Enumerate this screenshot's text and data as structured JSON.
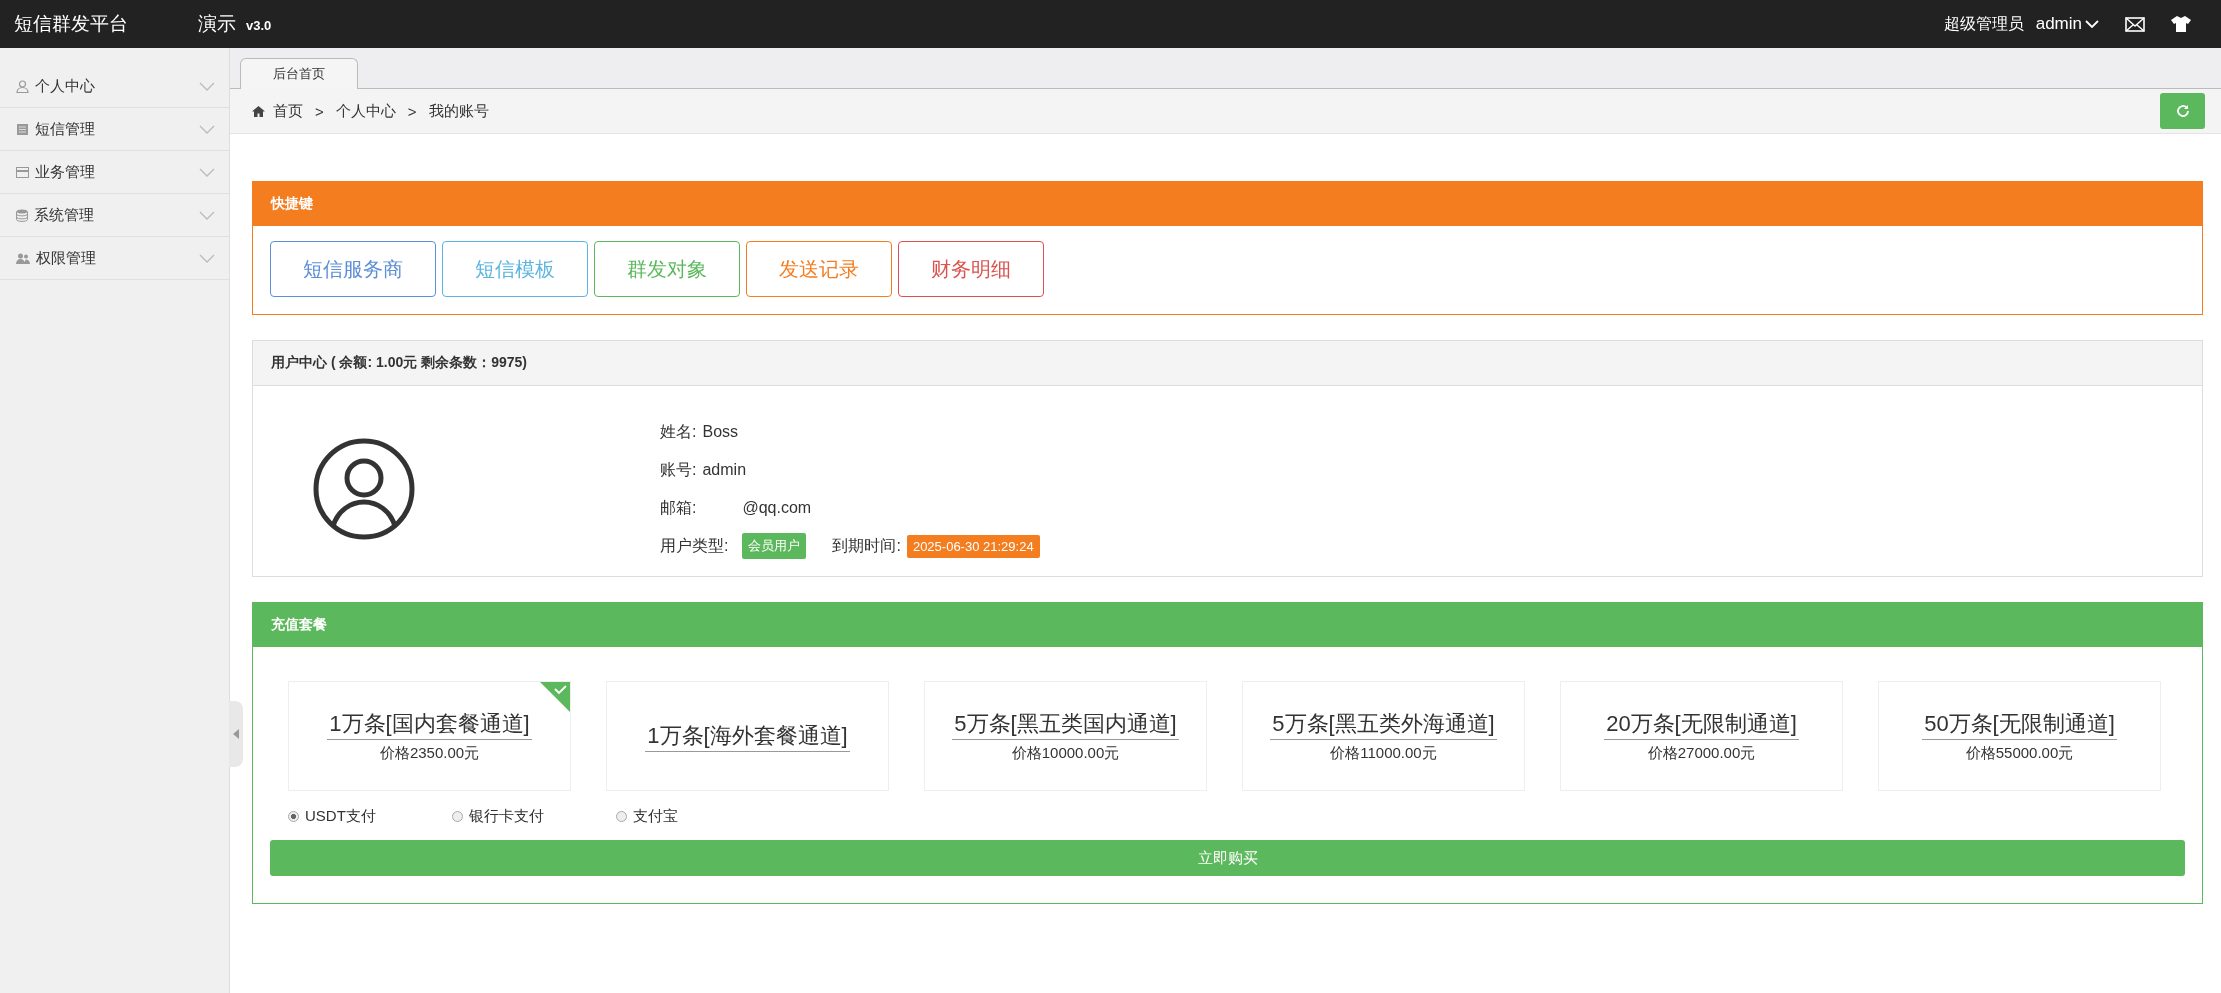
{
  "topbar": {
    "title": "短信群发平台",
    "title_tail": "演示",
    "version": "v3.0",
    "role": "超级管理员",
    "user": "admin"
  },
  "sidebar": {
    "items": [
      {
        "label": "个人中心",
        "kind": "user"
      },
      {
        "label": "短信管理",
        "kind": "doc"
      },
      {
        "label": "业务管理",
        "kind": "card"
      },
      {
        "label": "系统管理",
        "kind": "db"
      },
      {
        "label": "权限管理",
        "kind": "group"
      }
    ]
  },
  "tabs": [
    {
      "label": "后台首页",
      "selected": true
    }
  ],
  "breadcrumb": {
    "separator": ">",
    "items": [
      "首页",
      "个人中心",
      "我的账号"
    ]
  },
  "quick": {
    "title": "快捷键",
    "buttons": [
      {
        "label": "短信服务商",
        "color": "#5d8fd6"
      },
      {
        "label": "短信模板",
        "color": "#5bb5e0"
      },
      {
        "label": "群发对象",
        "color": "#5cb85c"
      },
      {
        "label": "发送记录",
        "color": "#f47d20"
      },
      {
        "label": "财务明细",
        "color": "#d9534f"
      }
    ]
  },
  "user": {
    "title": "用户中心 ( 余额: 1.00元 剩余条数：9975)",
    "fields": [
      {
        "label": "姓名:",
        "value": "Boss"
      },
      {
        "label": "账号:",
        "value": "admin"
      },
      {
        "label": "邮箱:",
        "value": "@qq.com"
      }
    ],
    "type_label": "用户类型:",
    "type_badge": "会员用户",
    "expiry_label": "到期时间:",
    "expiry_badge": "2025-06-30 21:29:24"
  },
  "packages": {
    "title": "充值套餐",
    "items": [
      {
        "name": "1万条[国内套餐通道]",
        "price": "价格2350.00元",
        "selected": true
      },
      {
        "name": "1万条[海外套餐通道]",
        "selected": false
      },
      {
        "name": "5万条[黑五类国内通道]",
        "price": "价格10000.00元",
        "selected": false
      },
      {
        "name": "5万条[黑五类外海通道]",
        "price": "价格11000.00元",
        "selected": false
      },
      {
        "name": "20万条[无限制通道]",
        "price": "价格27000.00元",
        "selected": false
      },
      {
        "name": "50万条[无限制通道]",
        "price": "价格55000.00元",
        "selected": false
      }
    ],
    "payments": [
      {
        "label": "USDT支付",
        "selected": true
      },
      {
        "label": "银行卡支付",
        "selected": false
      },
      {
        "label": "支付宝",
        "selected": false
      }
    ],
    "buy": "立即购买"
  }
}
